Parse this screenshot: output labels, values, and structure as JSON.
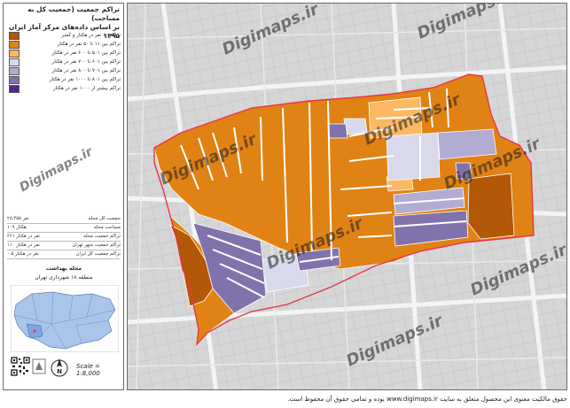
{
  "title": {
    "line1": "تراکم جمعیت (جمعیت کل به مساحت)",
    "line2": "بر اساس داده‌های مرکز آمار ایران ۱۳۹۵"
  },
  "legend": [
    {
      "label": "تراکم ۱۰ نفر در هکتار و کمتر",
      "color": "#b35806"
    },
    {
      "label": "تراکم بین ۱۱ تا ۵۰ نفر در هکتار",
      "color": "#e08214"
    },
    {
      "label": "تراکم بین ۵۰۱ تا ۶۰۰ نفر در هکتار",
      "color": "#fdb863"
    },
    {
      "label": "تراکم بین ۶۰۱ تا ۷۰۰ نفر در هکتار",
      "color": "#d8daeb"
    },
    {
      "label": "تراکم بین ۷۰۱ تا ۸۰۰ نفر در هکتار",
      "color": "#b2abd2"
    },
    {
      "label": "تراکم بین ۸۰۱ تا ۱۰۰۰ نفر در هکتار",
      "color": "#8073ac"
    },
    {
      "label": "تراکم بیشتر از ۱۰۰۰ نفر در هکتار",
      "color": "#542788"
    }
  ],
  "stats": [
    {
      "label": "جمعیت کل محله",
      "value": "۲۸,۴۵۵ نفر"
    },
    {
      "label": "مساحت محله",
      "value": "۱۰۹ هکتار"
    },
    {
      "label": "تراکم جمعیت محله",
      "value": "۲۶۱ نفر در هکتار"
    },
    {
      "label": "تراکم جمعیت شهر تهران",
      "value": "۱۱۰ نفر در هکتار"
    },
    {
      "label": "تراکم جمعیت کل ایران",
      "value": "۰.۵ نفر در هکتار"
    }
  ],
  "locator": {
    "neighborhood": "محله بهداشت",
    "district": "منطقه ۱۸ شهرداری تهران"
  },
  "scale_text": "Scale = 1:8,000",
  "north_label": "N",
  "watermark": "Digimaps.ir",
  "footer": "حقوق مالکیت معنوی این محصول متعلق به سایت www.digimaps.ir بوده و تمامی حقوق آن محفوظ است.",
  "colors": {
    "c10": "#b35806",
    "c50": "#e08214",
    "c600": "#fdb863",
    "c700": "#d8daeb",
    "c800": "#b2abd2",
    "c1000": "#8073ac",
    "cmax": "#542788",
    "boundary": "#e8344a"
  }
}
